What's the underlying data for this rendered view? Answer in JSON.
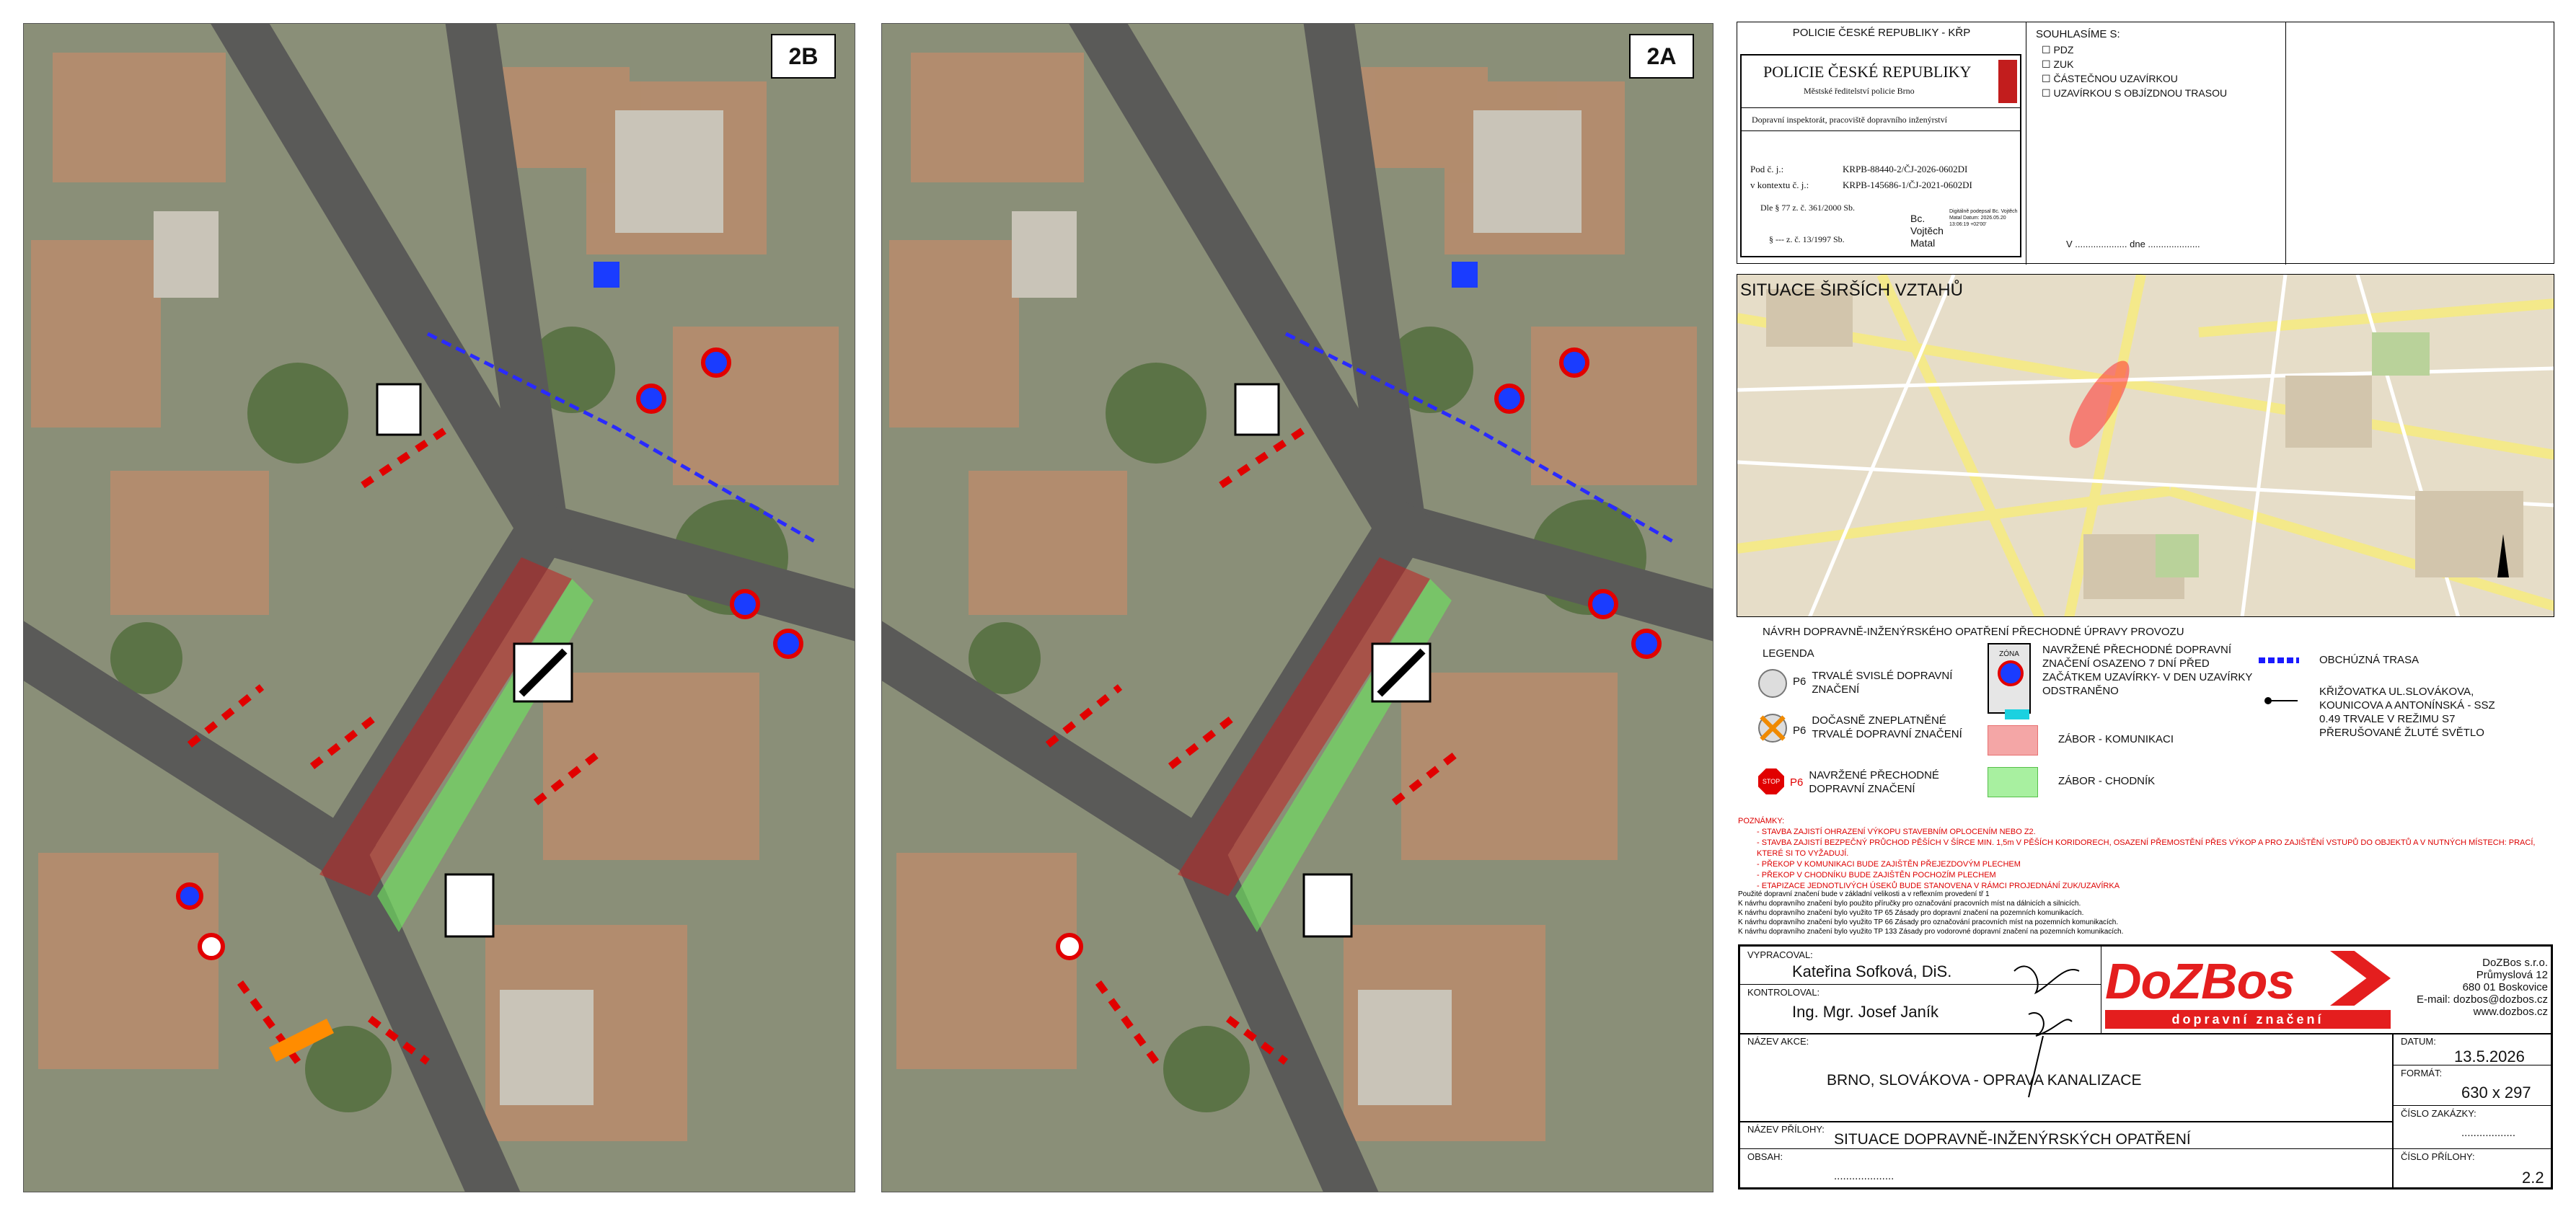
{
  "maps": {
    "left_label": "2B",
    "right_label": "2A"
  },
  "police": {
    "header": "POLICIE ČESKÉ REPUBLIKY - KŘP",
    "title": "POLICIE ČESKÉ REPUBLIKY",
    "subtitle": "Městské ředitelství policie Brno",
    "dept": "Dopravní inspektorát, pracoviště dopravního inženýrství",
    "pod_cj_label": "Pod č. j.:",
    "pod_cj_value": "KRPB-88440-2/ČJ-2026-0602DI",
    "kontext_label": "v kontextu č. j.:",
    "kontext_value": "KRPB-145686-1/ČJ-2021-0602DI",
    "law1": "Dle § 77 z. č. 361/2000 Sb.",
    "law2": "§ --- z. č. 13/1997 Sb.",
    "signer": "Bc. Vojtěch Matal",
    "sig_note": "Digitálně podepsal Bc. Vojtěch Matal Datum: 2026.05.20 13:06:19 +02'00'"
  },
  "approval": {
    "title": "SOUHLASÍME S:",
    "options": [
      "PDZ",
      "ZUK",
      "ČÁSTEČNOU UZAVÍRKOU",
      "UZAVÍRKOU S OBJÍZDNOU TRASOU"
    ],
    "date_line": "V .................... dne ...................."
  },
  "overview": {
    "title": "SITUACE ŠIRŠÍCH VZTAHŮ"
  },
  "legend": {
    "heading": "NÁVRH DOPRAVNĚ-INŽENÝRSKÉHO OPATŘENÍ PŘECHODNÉ ÚPRAVY PROVOZU",
    "legend_title": "LEGENDA",
    "p6_code": "P6",
    "items": {
      "trvale": "TRVALÉ SVISLÉ DOPRAVNÍ ZNAČENÍ",
      "docasne": "DOČASNĚ ZNEPLATNĚNÉ TRVALÉ DOPRAVNÍ ZNAČENÍ",
      "navrzene": "NAVRŽENÉ PŘECHODNÉ DOPRAVNÍ ZNAČENÍ",
      "osazeno": "NAVRŽENÉ PŘECHODNÉ DOPRAVNÍ ZNAČENÍ OSAZENO 7 DNÍ PŘED ZAČÁTKEM UZAVÍRKY- V DEN UZAVÍRKY ODSTRANĚNO",
      "zabor_kom": "ZÁBOR - KOMUNIKACI",
      "zabor_chod": "ZÁBOR - CHODNÍK",
      "objizdna": "OBCHÚZNÁ TRASA",
      "krizovatka": "KŘIŽOVATKA UL.SLOVÁKOVA, KOUNICOVA A ANTONÍNSKÁ - SSZ 0.49 TRVALE V REŽIMU S7 PŘERUŠOVANÉ ŽLUTÉ SVĚTLO"
    },
    "zona_sign": "ZÓNA",
    "notes_title": "POZNÁMKY:",
    "notes": [
      "STAVBA ZAJISTÍ OHRAZENÍ VÝKOPU STAVEBNÍM OPLOCENÍM NEBO Z2.",
      "STAVBA ZAJISTÍ BEZPEČNÝ PRŮCHOD PĚŠÍCH V ŠÍRCE MIN. 1,5m V PĚŠÍCH KORIDORECH, OSAZENÍ PŘEMOSTĚNÍ PŘES VÝKOP A PRO ZAJIŠTĚNÍ VSTUPŮ DO OBJEKTŮ A V NUTNÝCH MÍSTECH: PRACÍ, KTERÉ SI TO VYŽADUJÍ.",
      "PŘEKOP V KOMUNIKACI BUDE ZAJIŠTĚN PŘEJEZDOVÝM PLECHEM",
      "PŘEKOP V CHODNÍKU BUDE ZAJIŠTĚN POCHOZÍM PLECHEM",
      "ETAPIZACE JEDNOTLIVÝCH ÚSEKŮ BUDE STANOVENA V RÁMCI PROJEDNÁNÍ ZUK/UZAVÍRKA"
    ],
    "footnotes": [
      "Použité dopravní značení bude v základní velikosti a v reflexním provedení tř 1",
      "K návrhu dopravního značení bylo použito příručky pro označování pracovních míst na dálnicích a silnicích.",
      "K návrhu dopravního značení bylo využito TP 65 Zásady pro dopravní značení na pozemních komunikacích.",
      "K návrhu dopravního značení bylo využito TP 66 Zásady pro označování pracovních míst na pozemních komunikacích.",
      "K návrhu dopravního značení bylo využito TP 133 Zásady pro vodorovné dopravní značení na pozemních komunikacích."
    ]
  },
  "titleblock": {
    "vypracoval_label": "VYPRACOVAL:",
    "vypracoval": "Kateřina Sofková, DiS.",
    "kontroloval_label": "KONTROLOVAL:",
    "kontroloval": "Ing. Mgr. Josef Janík",
    "company_logo": "DoZBos",
    "company_tagline": "dopravní značení",
    "company_name": "DoZBos s.r.o.",
    "company_street": "Průmyslová 12",
    "company_city": "680 01 Boskovice",
    "company_email": "E-mail: dozbos@dozbos.cz",
    "company_web": "www.dozbos.cz",
    "akce_label": "NÁZEV AKCE:",
    "akce": "BRNO, SLOVÁKOVA - OPRAVA KANALIZACE",
    "datum_label": "DATUM:",
    "datum": "13.5.2026",
    "format_label": "FORMÁT:",
    "format": "630 x 297",
    "prilohy_label": "NÁZEV PŘÍLOHY:",
    "prilohy": "SITUACE DOPRAVNĚ-INŽENÝRSKÝCH OPATŘENÍ",
    "zakazky_label": "ČÍSLO ZAKÁZKY:",
    "zakazky": "..................",
    "obsah_label": "OBSAH:",
    "obsah": "....................",
    "cislo_prilohy_label": "ČÍSLO PŘÍLOHY:",
    "cislo_prilohy": "2.2"
  },
  "colors": {
    "zabor_komunikace": "#e87070",
    "zabor_chodnik": "#8fe07a",
    "logo_red": "#e41e1e",
    "notes_red": "#d40000"
  }
}
